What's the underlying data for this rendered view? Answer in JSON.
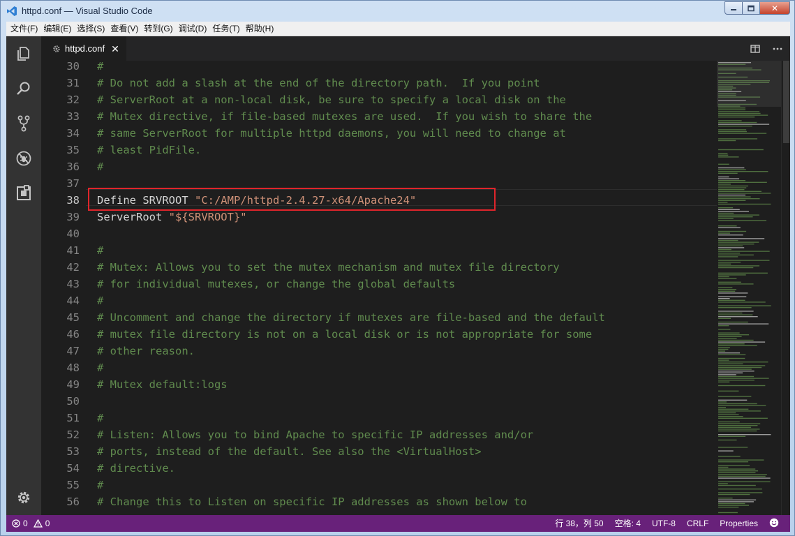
{
  "window": {
    "title": "httpd.conf — Visual Studio Code",
    "close_glyph": "✕"
  },
  "menu": [
    "文件(F)",
    "编辑(E)",
    "选择(S)",
    "查看(V)",
    "转到(G)",
    "调试(D)",
    "任务(T)",
    "帮助(H)"
  ],
  "tab": {
    "label": "httpd.conf",
    "close": "✕"
  },
  "icons": {
    "activity": [
      "files-icon",
      "search-icon",
      "source-control-icon",
      "debug-icon",
      "extensions-icon",
      "settings-gear-icon"
    ],
    "editor_actions": [
      "split-editor-icon",
      "more-actions-icon"
    ]
  },
  "editor": {
    "highlighted_line": 38,
    "lines": [
      {
        "n": "30",
        "parts": [
          {
            "t": "comment",
            "text": "#"
          }
        ]
      },
      {
        "n": "31",
        "parts": [
          {
            "t": "comment",
            "text": "# Do not add a slash at the end of the directory path.  If you point"
          }
        ]
      },
      {
        "n": "32",
        "parts": [
          {
            "t": "comment",
            "text": "# ServerRoot at a non-local disk, be sure to specify a local disk on the"
          }
        ]
      },
      {
        "n": "33",
        "parts": [
          {
            "t": "comment",
            "text": "# Mutex directive, if file-based mutexes are used.  If you wish to share the"
          }
        ]
      },
      {
        "n": "34",
        "parts": [
          {
            "t": "comment",
            "text": "# same ServerRoot for multiple httpd daemons, you will need to change at"
          }
        ]
      },
      {
        "n": "35",
        "parts": [
          {
            "t": "comment",
            "text": "# least PidFile."
          }
        ]
      },
      {
        "n": "36",
        "parts": [
          {
            "t": "comment",
            "text": "#"
          }
        ]
      },
      {
        "n": "37",
        "parts": []
      },
      {
        "n": "38",
        "parts": [
          {
            "t": "plain",
            "text": "Define SRVROOT "
          },
          {
            "t": "str",
            "text": "\"C:/AMP/httpd-2.4.27-x64/Apache24\""
          }
        ]
      },
      {
        "n": "39",
        "parts": [
          {
            "t": "plain",
            "text": "ServerRoot "
          },
          {
            "t": "str",
            "text": "\"${SRVROOT}\""
          }
        ]
      },
      {
        "n": "40",
        "parts": []
      },
      {
        "n": "41",
        "parts": [
          {
            "t": "comment",
            "text": "#"
          }
        ]
      },
      {
        "n": "42",
        "parts": [
          {
            "t": "comment",
            "text": "# Mutex: Allows you to set the mutex mechanism and mutex file directory"
          }
        ]
      },
      {
        "n": "43",
        "parts": [
          {
            "t": "comment",
            "text": "# for individual mutexes, or change the global defaults"
          }
        ]
      },
      {
        "n": "44",
        "parts": [
          {
            "t": "comment",
            "text": "#"
          }
        ]
      },
      {
        "n": "45",
        "parts": [
          {
            "t": "comment",
            "text": "# Uncomment and change the directory if mutexes are file-based and the default"
          }
        ]
      },
      {
        "n": "46",
        "parts": [
          {
            "t": "comment",
            "text": "# mutex file directory is not on a local disk or is not appropriate for some"
          }
        ]
      },
      {
        "n": "47",
        "parts": [
          {
            "t": "comment",
            "text": "# other reason."
          }
        ]
      },
      {
        "n": "48",
        "parts": [
          {
            "t": "comment",
            "text": "#"
          }
        ]
      },
      {
        "n": "49",
        "parts": [
          {
            "t": "comment",
            "text": "# Mutex default:logs"
          }
        ]
      },
      {
        "n": "50",
        "parts": []
      },
      {
        "n": "51",
        "parts": [
          {
            "t": "comment",
            "text": "#"
          }
        ]
      },
      {
        "n": "52",
        "parts": [
          {
            "t": "comment",
            "text": "# Listen: Allows you to bind Apache to specific IP addresses and/or"
          }
        ]
      },
      {
        "n": "53",
        "parts": [
          {
            "t": "comment",
            "text": "# ports, instead of the default. See also the <VirtualHost>"
          }
        ]
      },
      {
        "n": "54",
        "parts": [
          {
            "t": "comment",
            "text": "# directive."
          }
        ]
      },
      {
        "n": "55",
        "parts": [
          {
            "t": "comment",
            "text": "#"
          }
        ]
      },
      {
        "n": "56",
        "parts": [
          {
            "t": "comment",
            "text": "# Change this to Listen on specific IP addresses as shown below to"
          }
        ]
      }
    ]
  },
  "statusbar": {
    "errors": "0",
    "warnings": "0",
    "position": "行 38，列 50",
    "indent": "空格: 4",
    "encoding": "UTF-8",
    "eol": "CRLF",
    "language": "Properties"
  },
  "colors": {
    "statusbar": "#68217a",
    "activitybar": "#333333",
    "editor_bg": "#1e1e1e",
    "comment": "#608b4e",
    "string": "#ce9178",
    "highlight_box": "#e0252b"
  }
}
